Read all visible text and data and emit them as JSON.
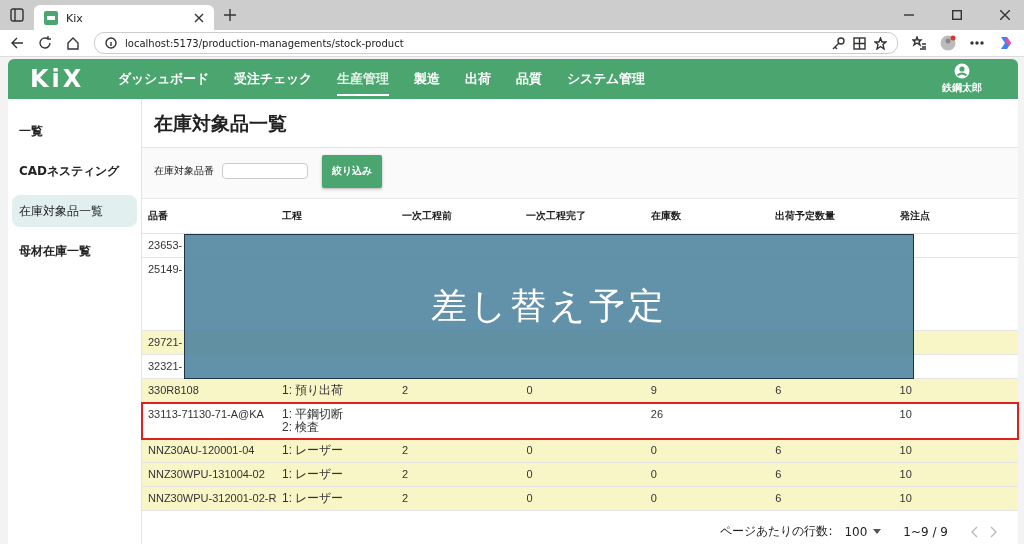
{
  "browser": {
    "tab_title": "Kix",
    "url": "localhost:5173/production-managements/stock-product"
  },
  "header": {
    "logo": "KiX",
    "nav": [
      {
        "label": "ダッシュボード",
        "selected": false
      },
      {
        "label": "受注チェック",
        "selected": false
      },
      {
        "label": "生産管理",
        "selected": true
      },
      {
        "label": "製造",
        "selected": false
      },
      {
        "label": "出荷",
        "selected": false
      },
      {
        "label": "品質",
        "selected": false
      },
      {
        "label": "システム管理",
        "selected": false
      }
    ],
    "user": "鉄鋼太郎"
  },
  "sidebar": {
    "items": [
      {
        "label": "一覧",
        "selected": false
      },
      {
        "label": "CADネスティング",
        "selected": false
      },
      {
        "label": "在庫対象品一覧",
        "selected": true
      },
      {
        "label": "母材在庫一覧",
        "selected": false
      }
    ]
  },
  "page_title": "在庫対象品一覧",
  "filter": {
    "label": "在庫対象品番",
    "button": "絞り込み"
  },
  "table": {
    "columns": [
      "品番",
      "工程",
      "一次工程前",
      "一次工程完了",
      "在庫数",
      "出荷予定数量",
      "発注点"
    ],
    "rows": [
      {
        "kind": "single",
        "highlighted": false,
        "flagged": false,
        "part_no": "23653-"
      },
      {
        "kind": "tall",
        "highlighted": false,
        "flagged": false,
        "part_no": "25149-"
      },
      {
        "kind": "single",
        "highlighted": true,
        "flagged": false,
        "part_no": "29721-"
      },
      {
        "kind": "single",
        "highlighted": false,
        "flagged": false,
        "part_no": "32321-"
      },
      {
        "kind": "single",
        "highlighted": true,
        "flagged": false,
        "part_no": "330R8108",
        "process": [
          "1: 預り出荷"
        ],
        "before": "2",
        "done": "0",
        "stock": "9",
        "shipping": "6",
        "reorder": "10"
      },
      {
        "kind": "single",
        "highlighted": false,
        "flagged": true,
        "part_no": "33113-71130-71-A@KA",
        "process": [
          "1: 平鋼切断",
          "2: 検査"
        ],
        "stock": "26",
        "reorder": "10"
      },
      {
        "kind": "single",
        "highlighted": true,
        "flagged": false,
        "part_no": "NNZ30AU-120001-04",
        "process": [
          "1: レーザー"
        ],
        "before": "2",
        "done": "0",
        "stock": "0",
        "shipping": "6",
        "reorder": "10"
      },
      {
        "kind": "single",
        "highlighted": true,
        "flagged": false,
        "part_no": "NNZ30WPU-131004-02",
        "process": [
          "1: レーザー"
        ],
        "before": "2",
        "done": "0",
        "stock": "0",
        "shipping": "6",
        "reorder": "10"
      },
      {
        "kind": "single",
        "highlighted": true,
        "flagged": false,
        "part_no": "NNZ30WPU-312001-02-R",
        "process": [
          "1: レーザー"
        ],
        "before": "2",
        "done": "0",
        "stock": "0",
        "shipping": "6",
        "reorder": "10"
      }
    ]
  },
  "pagination": {
    "rows_label": "ページあたりの行数:",
    "rows_per_page": "100",
    "range": "1~9 / 9"
  },
  "overlay": {
    "text": "差し替え予定"
  }
}
